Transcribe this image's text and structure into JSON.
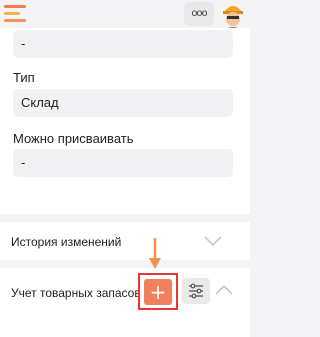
{
  "header": {
    "more_label": "ooo"
  },
  "fields": {
    "first_value": "-",
    "type_label": "Тип",
    "type_value": "Склад",
    "assign_label": "Можно присваивать",
    "assign_value": "-"
  },
  "sections": {
    "history_label": "История изменений",
    "inventory_label": "Учет товарных запасов"
  },
  "buttons": {
    "add_label": "+"
  },
  "colors": {
    "accent": "#f0825b",
    "highlight": "#e53935",
    "arrow": "#f0914f"
  }
}
